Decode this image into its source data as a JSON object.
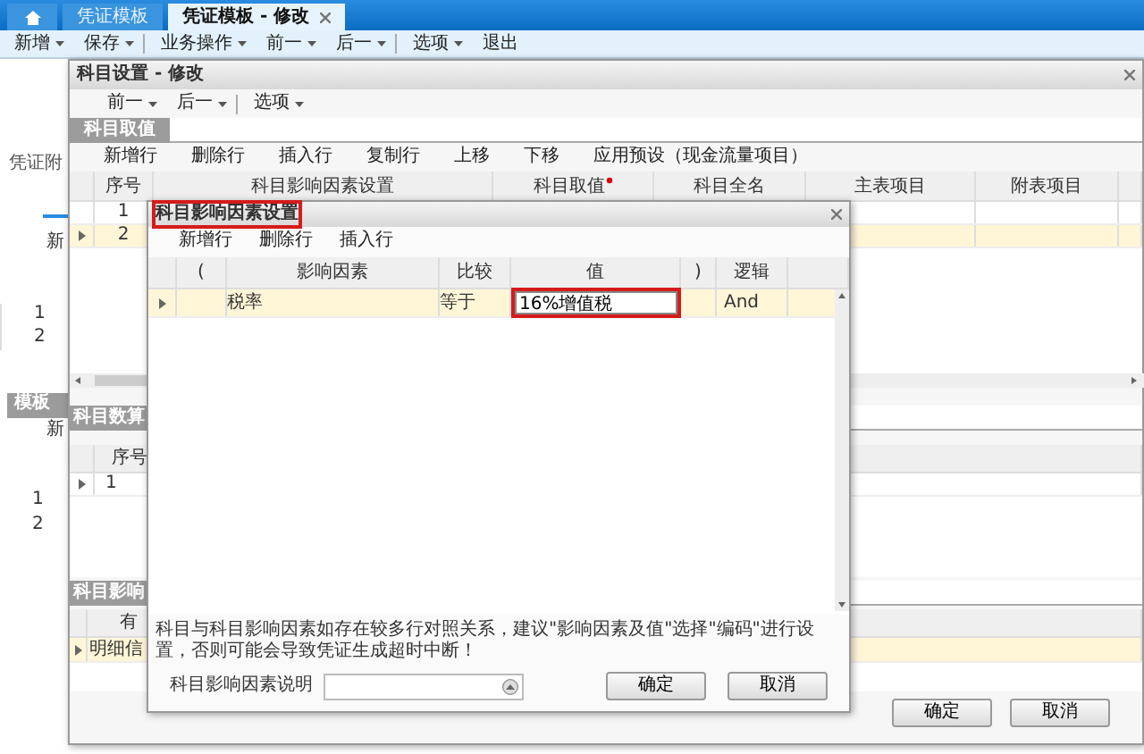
{
  "tabs": [
    {
      "kind": "home",
      "selected": false
    },
    {
      "kind": "text",
      "label": "凭证模板",
      "selected": false,
      "closable": false
    },
    {
      "kind": "text",
      "label": "凭证模板 - 修改",
      "selected": true,
      "closable": true
    }
  ],
  "menu": [
    {
      "label": "新增",
      "dropdown": true,
      "separator_after": false
    },
    {
      "label": "保存",
      "dropdown": true,
      "separator_after": true
    },
    {
      "label": "业务操作",
      "dropdown": true,
      "separator_after": false
    },
    {
      "label": "前一",
      "dropdown": true,
      "separator_after": false
    },
    {
      "label": "后一",
      "dropdown": true,
      "separator_after": true
    },
    {
      "label": "选项",
      "dropdown": true,
      "separator_after": false
    },
    {
      "label": "退出",
      "dropdown": false,
      "separator_after": false
    }
  ],
  "background": {
    "side_label": "凭证附",
    "upper_toolbar": "新",
    "upper_rows": [
      "1",
      "2"
    ],
    "lower_tab": "模板",
    "lower_toolbar": "新",
    "lower_rows": [
      "1",
      "2"
    ]
  },
  "subject_dialog": {
    "title": "科目设置 - 修改",
    "toolbar": [
      {
        "label": "前一",
        "dropdown": true,
        "separator_after": false
      },
      {
        "label": "后一",
        "dropdown": true,
        "separator_after": true
      },
      {
        "label": "选项",
        "dropdown": true,
        "separator_after": false
      }
    ],
    "tabs": [
      {
        "label": "科目取值",
        "selected": true
      }
    ],
    "grid_toolbar": [
      "新增行",
      "删除行",
      "插入行",
      "复制行",
      "上移",
      "下移",
      "应用预设（现金流量项目）"
    ],
    "columns": [
      {
        "label": "序号",
        "required": false
      },
      {
        "label": "科目影响因素设置",
        "required": false
      },
      {
        "label": "科目取值",
        "required": true
      },
      {
        "label": "科目全名",
        "required": false
      },
      {
        "label": "主表项目",
        "required": false
      },
      {
        "label": "附表项目",
        "required": false
      }
    ],
    "rows": [
      {
        "number": "1",
        "current": false,
        "selected": false
      },
      {
        "number": "2",
        "current": true,
        "selected": true
      }
    ],
    "section_2": {
      "tab": "科目数算",
      "column": "序号",
      "rows": [
        {
          "number": "1",
          "current": true,
          "selected": false
        }
      ]
    },
    "section_3": {
      "tab": "科目影响",
      "column": "有",
      "rows": [
        {
          "cell": "明细信",
          "current": true,
          "selected": true
        }
      ]
    },
    "buttons": [
      "确定",
      "取消"
    ]
  },
  "factor_dialog": {
    "title": "科目影响因素设置",
    "title_highlighted": true,
    "toolbar": [
      "新增行",
      "删除行",
      "插入行"
    ],
    "columns": [
      "(",
      "影响因素",
      "比较",
      "值",
      ")",
      "逻辑"
    ],
    "rows": [
      {
        "current": true,
        "selected": true,
        "factor": "税率",
        "compare": "等于",
        "value": "16%增值税",
        "value_highlighted": true,
        "logic": "And"
      }
    ],
    "note": "科目与科目影响因素如存在较多行对照关系，建议\"影响因素及值\"选择\"编码\"进行设置，否则可能会导致凭证生成超时中断！",
    "description_label": "科目影响因素说明",
    "buttons": [
      "确定",
      "取消"
    ]
  }
}
